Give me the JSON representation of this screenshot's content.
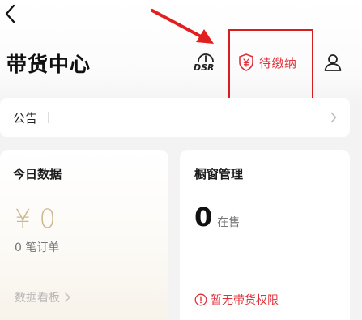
{
  "header": {
    "title": "带货中心",
    "dsr_label": "DSR",
    "pending_label": "待缴纳",
    "back_icon": "chevron-left-icon",
    "user_icon": "user-icon"
  },
  "notice": {
    "label": "公告"
  },
  "today": {
    "title": "今日数据",
    "gmv": "¥ 0",
    "orders": "0 笔订单",
    "dashboard_link": "数据看板"
  },
  "showcase": {
    "title": "橱窗管理",
    "count": "0",
    "count_unit": "在售",
    "no_permission": "暂无带货权限"
  },
  "colors": {
    "accent_red": "#e0313a",
    "gold": "#ccb98f",
    "annotation_red": "#d71d1d"
  }
}
